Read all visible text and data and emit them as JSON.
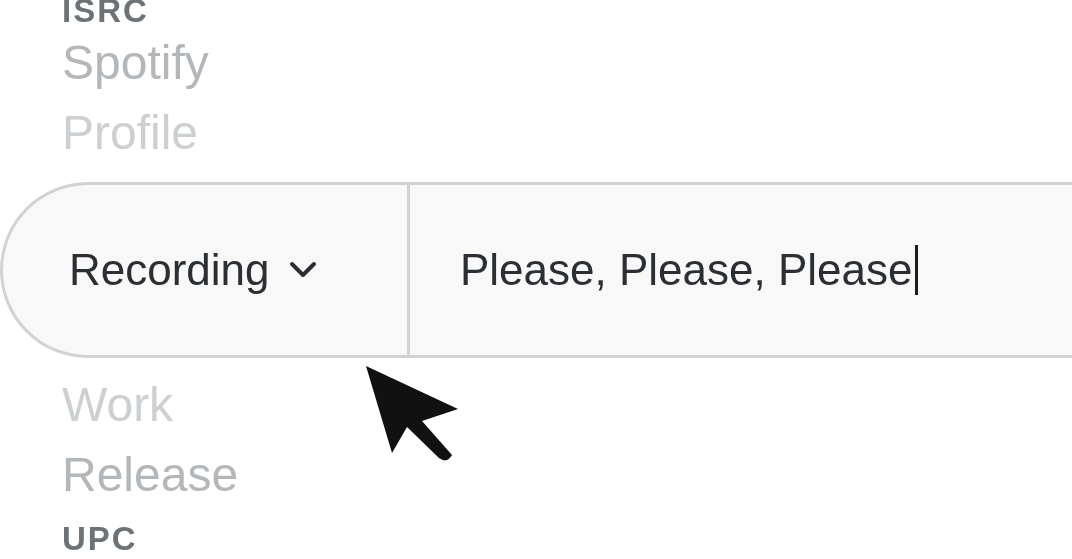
{
  "options_above": [
    {
      "label": "ISRC",
      "kind": "code",
      "color": "#6d7277"
    },
    {
      "label": "Spotify",
      "kind": "entity",
      "color": "#b4b7ba"
    },
    {
      "label": "Profile",
      "kind": "entity",
      "color": "#cdd0d2"
    }
  ],
  "search_bar": {
    "type_dropdown": {
      "label": "Recording"
    },
    "query": {
      "value": "Please, Please, Please",
      "focused": true
    }
  },
  "options_below": [
    {
      "label": "Work",
      "kind": "entity",
      "color": "#cdd0d2"
    },
    {
      "label": "Release",
      "kind": "entity",
      "color": "#b4b7ba"
    },
    {
      "label": "UPC",
      "kind": "code",
      "color": "#6d7277"
    }
  ]
}
